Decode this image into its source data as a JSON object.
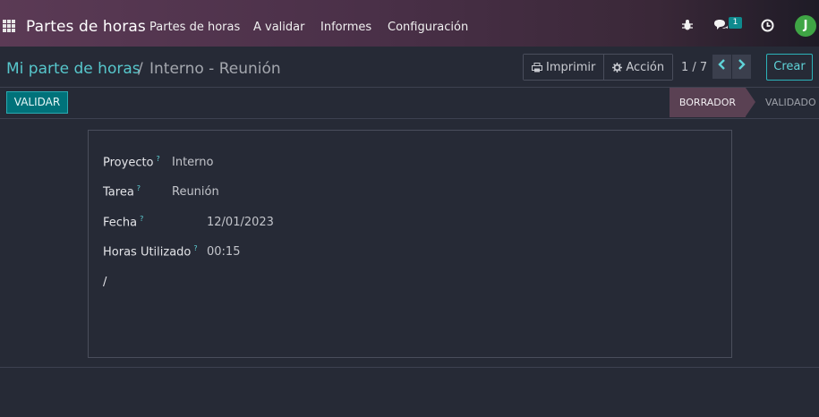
{
  "navbar": {
    "app_title": "Partes de horas",
    "menu": [
      "Partes de horas",
      "A validar",
      "Informes",
      "Configuración"
    ],
    "messages_badge": "1",
    "avatar_initial": "J"
  },
  "breadcrumb": {
    "root": "Mi parte de horas",
    "separator": "/",
    "current": "Interno - Reunión"
  },
  "toolbar": {
    "print_label": "Imprimir",
    "action_label": "Acción",
    "pager": "1 / 7",
    "create_label": "Crear"
  },
  "statusbar": {
    "validate_label": "VALIDAR",
    "stages": [
      "BORRADOR",
      "VALIDADO"
    ],
    "active_stage": "BORRADOR"
  },
  "form": {
    "fields": [
      {
        "label": "Proyecto",
        "help": "?",
        "value": "Interno"
      },
      {
        "label": "Tarea",
        "help": "?",
        "value": "Reunión"
      },
      {
        "label": "Fecha",
        "help": "?",
        "value": "12/01/2023"
      },
      {
        "label": "Horas Utilizado",
        "help": "?",
        "value": "00:15"
      }
    ],
    "description": "/"
  },
  "colors": {
    "accent": "#5fd3d8",
    "primary_button": "#00727a",
    "active_stage": "#5a4153"
  }
}
